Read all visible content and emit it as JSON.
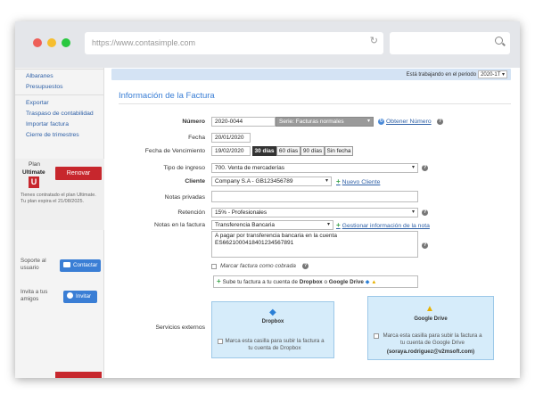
{
  "browser": {
    "url": "https://www.contasimple.com"
  },
  "sidebar": {
    "links": [
      "Albaranes",
      "Presupuestos",
      "Exportar",
      "Traspaso de contabilidad",
      "Importar factura",
      "Cierre de trimestres"
    ],
    "plan_label": "Plan",
    "plan_name": "Ultimate",
    "plan_badge": "U",
    "renew_label": "Renovar",
    "plan_info": "Tienes contratado el plan Ultimate. Tu plan expira el 21/08/2025.",
    "support_text": "Soporte al usuario",
    "contact_label": "Contactar",
    "invite_text": "Invita a tus amigos",
    "invite_label": "Invitar"
  },
  "header": {
    "period_text": "Está trabajando en el periodo",
    "period_value": "2020-1T"
  },
  "form": {
    "title": "Información de la Factura",
    "numero_label": "Número",
    "numero_value": "2020-0044",
    "serie_value": "Serie: Facturas normales",
    "obtener_label": "Obtener Número",
    "fecha_label": "Fecha",
    "fecha_value": "20/01/2020",
    "vencimiento_label": "Fecha de Vencimiento",
    "vencimiento_value": "19/02/2020",
    "due_options": [
      "30 días",
      "60 días",
      "90 días",
      "Sin fecha"
    ],
    "tipo_label": "Tipo de ingreso",
    "tipo_value": "700. Venta de mercaderías",
    "cliente_label": "Cliente",
    "cliente_value": "Company S.A - GB123456789",
    "nuevo_cliente_label": "Nuevo Cliente",
    "notas_priv_label": "Notas privadas",
    "notas_priv_value": "",
    "retencion_label": "Retención",
    "retencion_value": "15% - Profesionales",
    "notas_fact_label": "Notas en la factura",
    "notas_fact_value": "Transferencia Bancaria",
    "gestionar_label": "Gestionar información de la nota",
    "notas_text": "A pagar por transferencia bancaria en la cuenta ES6621000418401234567891",
    "cobrada_label": "Marcar factura como cobrada",
    "servicios_label": "Servicios externos",
    "servicios_text_pre": "Sube tu factura a tu cuenta de",
    "servicios_dropbox": "Dropbox",
    "servicios_o": "o",
    "servicios_gdrive": "Google Drive"
  },
  "cards": {
    "dropbox_title": "Dropbox",
    "dropbox_text": "Marca esta casilla para subir la factura a tu cuenta de Dropbox",
    "gdrive_title": "Google Drive",
    "gdrive_text": "Marca esta casilla para subir la factura a tu cuenta de Google Drive",
    "gdrive_email": "(soraya.rodriguez@v2msoft.com)"
  }
}
